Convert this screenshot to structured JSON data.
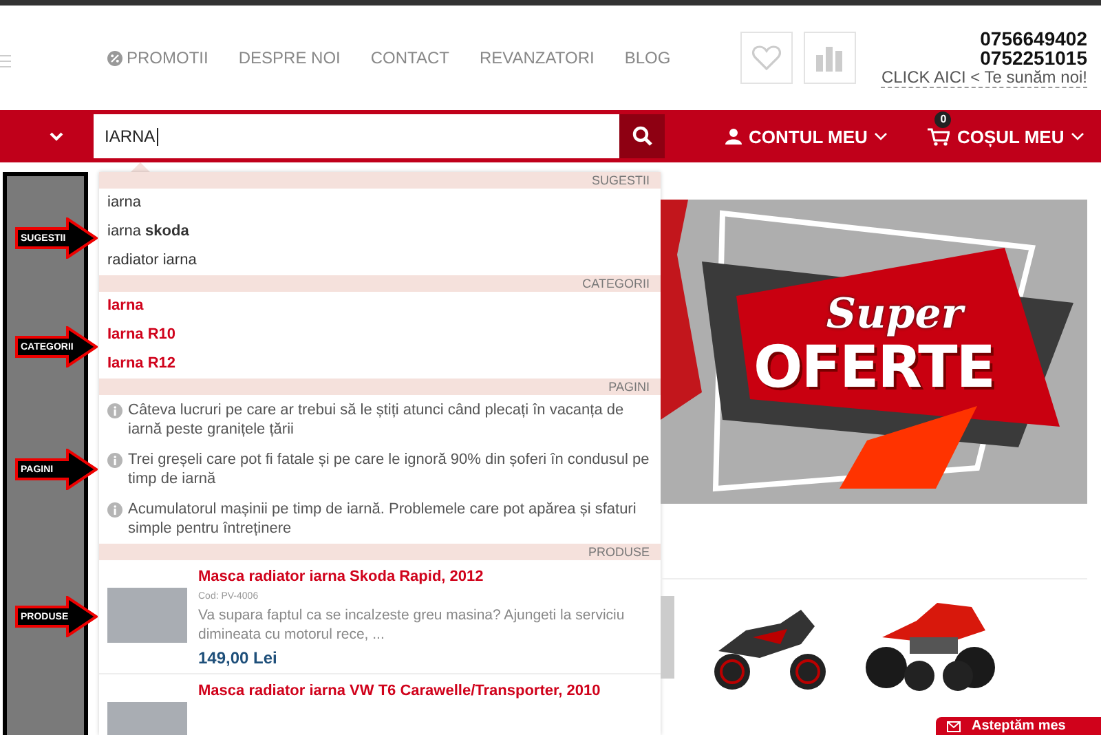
{
  "header": {
    "nav_links": [
      {
        "label": "PROMOTII",
        "kind": "promo"
      },
      {
        "label": "DESPRE NOI",
        "kind": "plain"
      },
      {
        "label": "CONTACT",
        "kind": "plain"
      },
      {
        "label": "REVANZATORI",
        "kind": "plain"
      },
      {
        "label": "BLOG",
        "kind": "plain"
      }
    ],
    "phones": [
      "0756649402",
      "0752251015"
    ],
    "callback_link": "CLICK AICI < Te sunăm noi!"
  },
  "search_bar": {
    "value": "IARNA",
    "account": "CONTUL MEU",
    "cart": {
      "label": "COȘUL MEU",
      "count": "0"
    }
  },
  "dropdown": {
    "sections": [
      {
        "kind": "suggestions",
        "title": "SUGESTII",
        "items": [
          {
            "text": "iarna"
          },
          {
            "text": "iarna **skoda**"
          },
          {
            "text": "radiator iarna"
          }
        ]
      },
      {
        "kind": "categories",
        "title": "CATEGORII",
        "items": [
          {
            "text": "Iarna"
          },
          {
            "text": "Iarna R10"
          },
          {
            "text": "Iarna R12"
          }
        ]
      },
      {
        "kind": "pages",
        "title": "PAGINI",
        "items": [
          {
            "text": "Câteva lucruri pe care ar trebui să le știți atunci când plecați în vacanța de iarnă peste granițele țării"
          },
          {
            "text": "Trei greșeli care pot fi fatale și pe care le ignoră 90% din șoferi în condusul pe timp de iarnă"
          },
          {
            "text": "Acumulatorul mașinii pe timp de iarnă. Problemele care pot apărea și sfaturi simple pentru întreținere"
          }
        ]
      },
      {
        "kind": "products",
        "title": "PRODUSE",
        "items": [
          {
            "name": "Masca radiator iarna Skoda Rapid, 2012",
            "code": "Cod: PV-4006",
            "description": "Va supara faptul ca se incalzeste greu masina? Ajungeti la serviciu dimineata cu motorul rece, ...",
            "price": "149,00 Lei"
          },
          {
            "name": "Masca radiator iarna VW T6 Carawelle/Transporter, 2010"
          }
        ]
      }
    ]
  },
  "annotations": [
    {
      "label": "SUGESTII"
    },
    {
      "label": "CATEGORII"
    },
    {
      "label": "PAGINI"
    },
    {
      "label": "PRODUSE"
    }
  ],
  "banner": {
    "script_text": "Super",
    "title": "OFERTE"
  },
  "chat_button": {
    "label": "Asteptăm mes"
  }
}
